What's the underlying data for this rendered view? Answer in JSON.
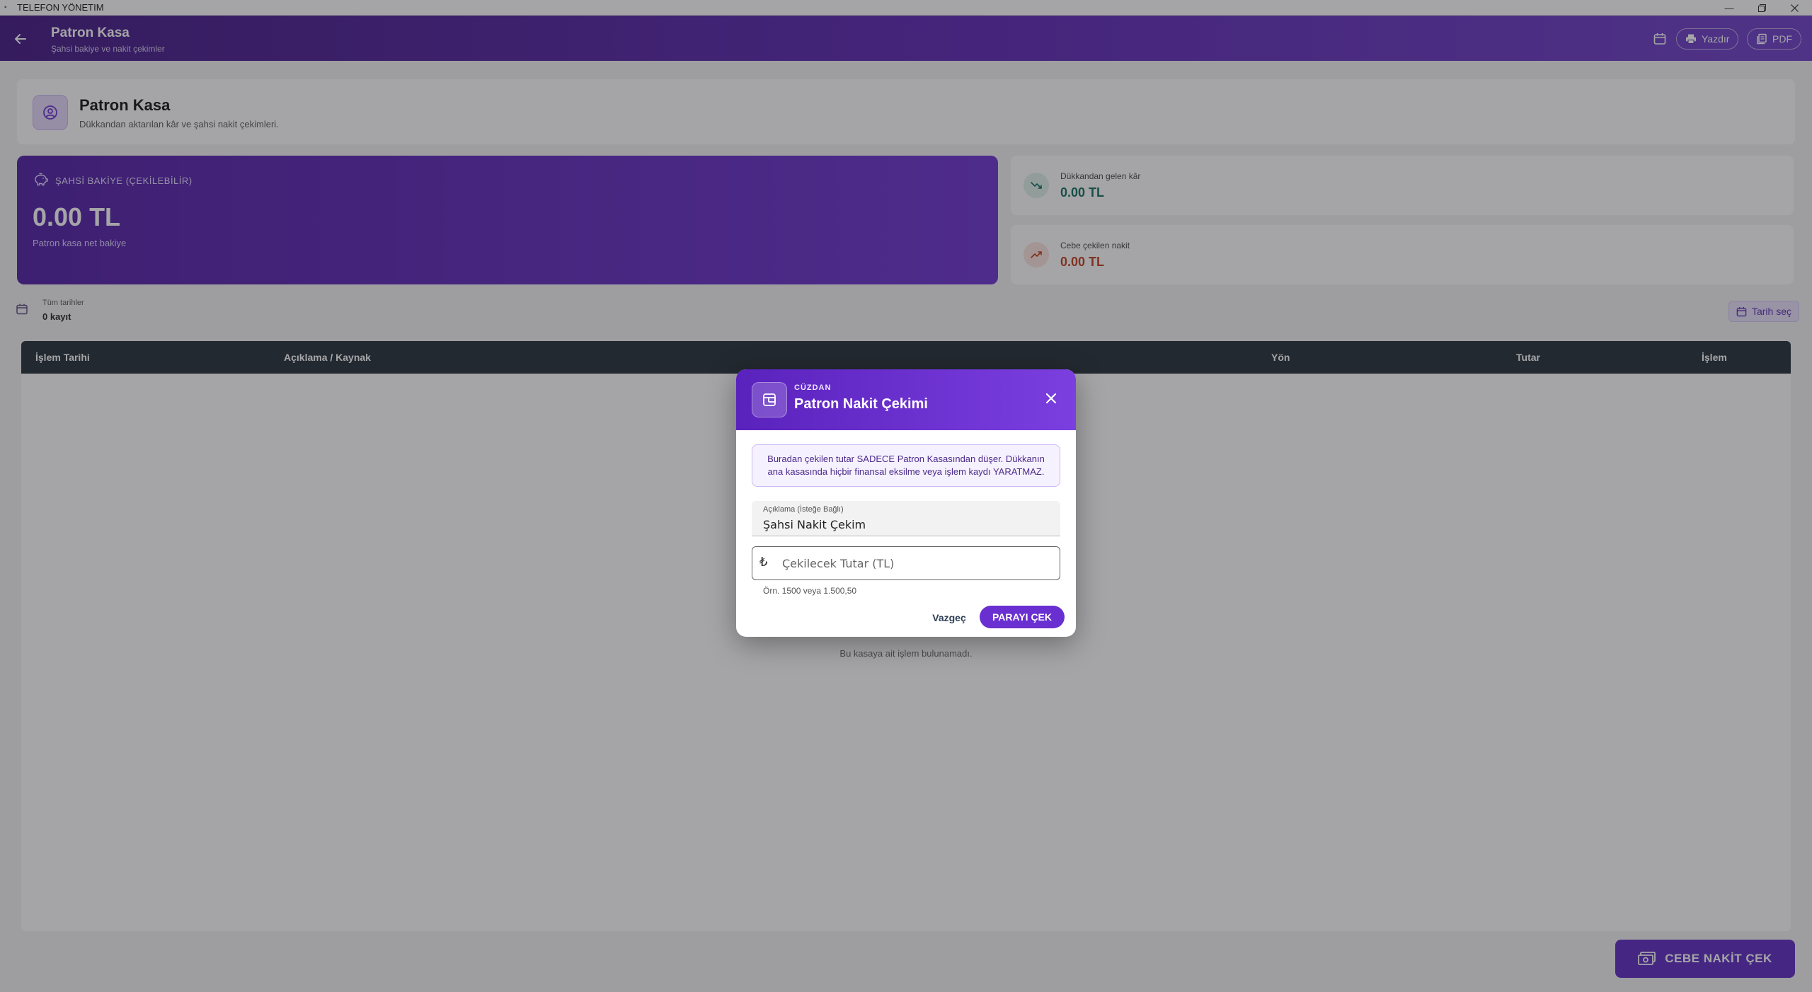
{
  "window": {
    "title": "TELEFON YÖNETIM"
  },
  "appbar": {
    "title": "Patron Kasa",
    "subtitle": "Şahsi bakiye ve nakit çekimler",
    "print_label": "Yazdır",
    "pdf_label": "PDF"
  },
  "header_card": {
    "title": "Patron Kasa",
    "subtitle": "Dükkandan aktarılan kâr ve şahsi nakit çekimleri."
  },
  "balance": {
    "label": "ŞAHSİ BAKİYE (ÇEKİLEBİLİR)",
    "amount": "0.00 TL",
    "subtitle": "Patron kasa net bakiye"
  },
  "stats": [
    {
      "label": "Dükkandan gelen kâr",
      "value": "0.00 TL",
      "color": "#0f6b5c"
    },
    {
      "label": "Cebe çekilen nakit",
      "value": "0.00 TL",
      "color": "#c0391b"
    }
  ],
  "filter": {
    "range_label": "Tüm tarihler",
    "count_label": "0 kayıt",
    "date_button_label": "Tarih seç"
  },
  "table": {
    "columns": [
      "İşlem Tarihi",
      "Açıklama / Kaynak",
      "Yön",
      "Tutar",
      "İşlem"
    ],
    "empty_text": "Bu kasaya ait işlem bulunamadı."
  },
  "fab": {
    "label": "CEBE NAKİT ÇEK"
  },
  "modal": {
    "kicker": "CÜZDAN",
    "title": "Patron Nakit Çekimi",
    "notice_line1": "Buradan çekilen tutar SADECE Patron Kasasından düşer. Dükkanın",
    "notice_line2": "ana kasasında hiçbir finansal eksilme veya işlem kaydı YARATMAZ.",
    "description_label": "Açıklama (İsteğe Bağlı)",
    "description_value": "Şahsi Nakit Çekim",
    "currency_symbol": "₺",
    "amount_placeholder": "Çekilecek Tutar (TL)",
    "amount_hint": "Örn. 1500 veya 1.500,50",
    "cancel_label": "Vazgeç",
    "confirm_label": "PARAYI ÇEK"
  }
}
